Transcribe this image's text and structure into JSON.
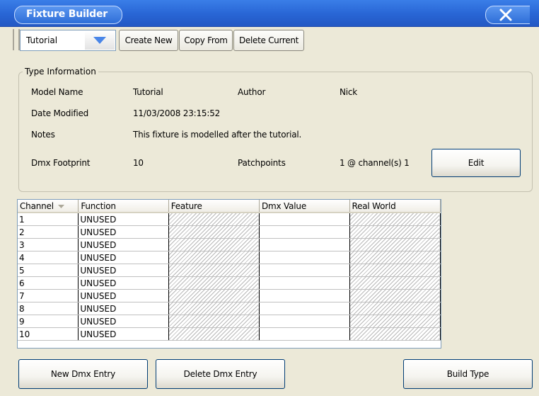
{
  "window": {
    "title": "Fixture Builder"
  },
  "toolbar": {
    "fixture_selected": "Tutorial",
    "create_new": "Create New",
    "copy_from": "Copy From",
    "delete_current": "Delete Current"
  },
  "type_info": {
    "legend": "Type Information",
    "model_name_label": "Model Name",
    "model_name_value": "Tutorial",
    "author_label": "Author",
    "author_value": "Nick",
    "date_modified_label": "Date Modified",
    "date_modified_value": "11/03/2008 23:15:52",
    "notes_label": "Notes",
    "notes_value": "This fixture is modelled after the tutorial.",
    "dmx_footprint_label": "Dmx Footprint",
    "dmx_footprint_value": "10",
    "patchpoints_label": "Patchpoints",
    "patchpoints_value": "1 @ channel(s) 1",
    "edit_button": "Edit"
  },
  "grid": {
    "columns": [
      "Channel",
      "Function",
      "Feature",
      "Dmx Value",
      "Real World"
    ],
    "rows": [
      {
        "channel": "1",
        "function": "UNUSED"
      },
      {
        "channel": "2",
        "function": "UNUSED"
      },
      {
        "channel": "3",
        "function": "UNUSED"
      },
      {
        "channel": "4",
        "function": "UNUSED"
      },
      {
        "channel": "5",
        "function": "UNUSED"
      },
      {
        "channel": "6",
        "function": "UNUSED"
      },
      {
        "channel": "7",
        "function": "UNUSED"
      },
      {
        "channel": "8",
        "function": "UNUSED"
      },
      {
        "channel": "9",
        "function": "UNUSED"
      },
      {
        "channel": "10",
        "function": "UNUSED"
      }
    ]
  },
  "footer": {
    "new_dmx_entry": "New Dmx Entry",
    "delete_dmx_entry": "Delete Dmx Entry",
    "build_type": "Build Type"
  },
  "icons": {
    "close": "close-icon",
    "dropdown": "chevron-down-icon",
    "sort": "sort-down-icon"
  },
  "colors": {
    "titlebar": "#2865d4",
    "face": "#ece9d8",
    "accent": "#4a86e8"
  }
}
